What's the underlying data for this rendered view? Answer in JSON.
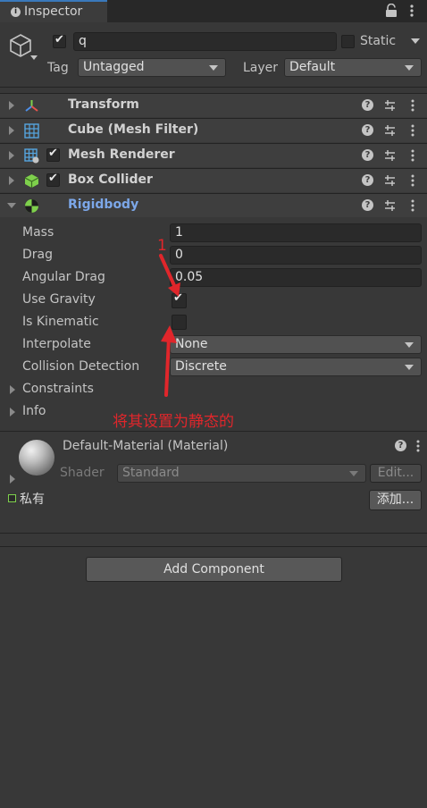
{
  "tab": {
    "title": "Inspector"
  },
  "gameobject": {
    "name": "q",
    "active": true,
    "static_label": "Static",
    "static_checked": false,
    "tag_label": "Tag",
    "tag_value": "Untagged",
    "layer_label": "Layer",
    "layer_value": "Default"
  },
  "components": [
    {
      "title": "Transform",
      "icon": "transform-icon",
      "has_checkbox": false
    },
    {
      "title": "Cube (Mesh Filter)",
      "icon": "mesh-filter-icon",
      "has_checkbox": false
    },
    {
      "title": "Mesh Renderer",
      "icon": "mesh-renderer-icon",
      "has_checkbox": true,
      "enabled": true
    },
    {
      "title": "Box Collider",
      "icon": "box-collider-icon",
      "has_checkbox": true,
      "enabled": true
    },
    {
      "title": "Rigidbody",
      "icon": "rigidbody-icon",
      "has_checkbox": false,
      "expanded": true
    }
  ],
  "rigidbody": {
    "mass_label": "Mass",
    "mass": "1",
    "drag_label": "Drag",
    "drag": "0",
    "angular_drag_label": "Angular Drag",
    "angular_drag": "0.05",
    "use_gravity_label": "Use Gravity",
    "use_gravity": true,
    "is_kinematic_label": "Is Kinematic",
    "is_kinematic": false,
    "interpolate_label": "Interpolate",
    "interpolate": "None",
    "collision_detection_label": "Collision Detection",
    "collision_detection": "Discrete",
    "constraints_label": "Constraints",
    "info_label": "Info"
  },
  "annotation": {
    "number": "1",
    "text": "将其设置为静态的",
    "color": "#e0262b"
  },
  "material": {
    "title": "Default-Material (Material)",
    "shader_label": "Shader",
    "shader_value": "Standard",
    "edit_label": "Edit...",
    "private_label": "私有",
    "add_label": "添加..."
  },
  "add_component_label": "Add Component",
  "colors": {
    "accent": "#3a79bb",
    "rigidbody_title": "#7ca7e8",
    "panel": "#383838"
  }
}
